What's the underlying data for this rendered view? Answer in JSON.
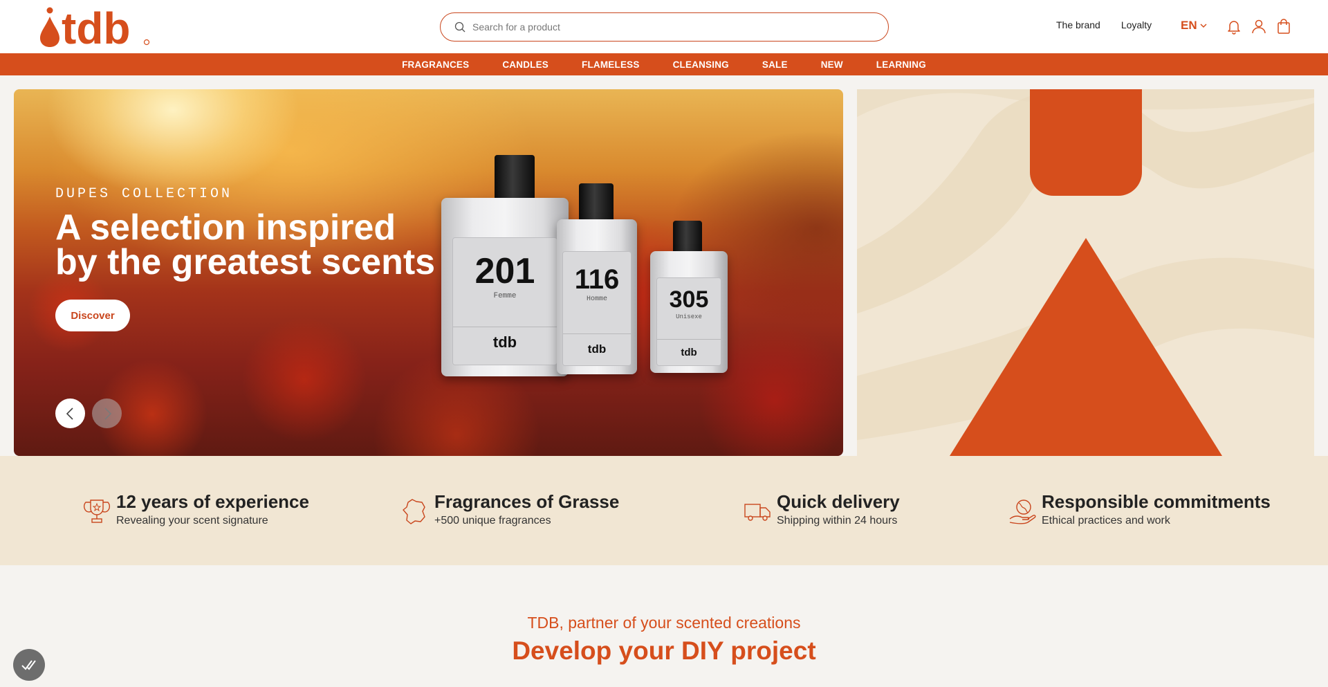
{
  "header": {
    "logo_text": "tdb",
    "search_placeholder": "Search for a product",
    "links": [
      "The brand",
      "Loyalty"
    ],
    "language": "EN"
  },
  "nav": [
    "FRAGRANCES",
    "CANDLES",
    "FLAMELESS",
    "CLEANSING",
    "SALE",
    "NEW",
    "LEARNING"
  ],
  "hero": {
    "eyebrow": "DUPES COLLECTION",
    "title_line1": "A selection inspired",
    "title_line2": "by the greatest scents",
    "cta": "Discover",
    "bottles": [
      {
        "number": "201",
        "type": "Femme",
        "brand": "tdb"
      },
      {
        "number": "116",
        "type": "Homme",
        "brand": "tdb"
      },
      {
        "number": "305",
        "type": "Unisexe",
        "brand": "tdb"
      }
    ]
  },
  "features": [
    {
      "icon": "trophy-icon",
      "title": "12 years of experience",
      "subtitle": "Revealing your scent signature"
    },
    {
      "icon": "france-map-icon",
      "title": "Fragrances of Grasse",
      "subtitle": "+500 unique fragrances"
    },
    {
      "icon": "delivery-truck-icon",
      "title": "Quick delivery",
      "subtitle": "Shipping within 24 hours"
    },
    {
      "icon": "globe-hand-icon",
      "title": "Responsible commitments",
      "subtitle": "Ethical practices and work"
    }
  ],
  "section": {
    "subtitle": "TDB, partner of your scented creations",
    "title": "Develop your DIY project"
  },
  "colors": {
    "brand": "#d64e1c",
    "cream": "#f1e6d3",
    "page_bg": "#f5f3f0"
  }
}
